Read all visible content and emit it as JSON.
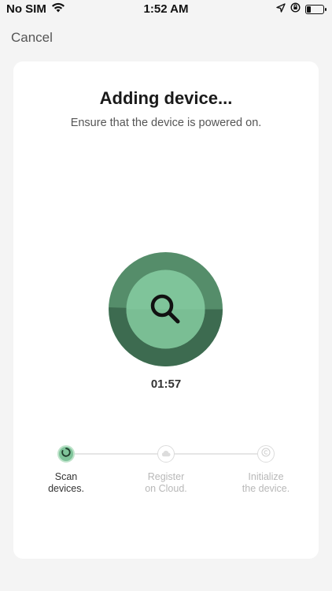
{
  "status_bar": {
    "carrier": "No SIM",
    "time": "1:52 AM",
    "icons": [
      "wifi-icon",
      "location-arrow-icon",
      "orientation-lock-icon",
      "battery-icon"
    ]
  },
  "nav": {
    "cancel_label": "Cancel"
  },
  "main": {
    "title": "Adding device...",
    "subtitle": "Ensure that the device is powered on.",
    "timer": "01:57",
    "scanner_icon": "search-icon"
  },
  "steps": [
    {
      "line1": "Scan",
      "line2": "devices.",
      "state": "active",
      "icon": "spinner-icon"
    },
    {
      "line1": "Register",
      "line2": "on Cloud.",
      "state": "pending",
      "icon": "cloud-icon"
    },
    {
      "line1": "Initialize",
      "line2": "the device.",
      "state": "pending",
      "icon": "copyright-icon"
    }
  ],
  "colors": {
    "ring_dark": "#3d6b50",
    "ring_mid": "#558d6a",
    "inner": "#7fc49a",
    "accent": "#7fc49a",
    "pending_text": "#b8b8b8"
  }
}
